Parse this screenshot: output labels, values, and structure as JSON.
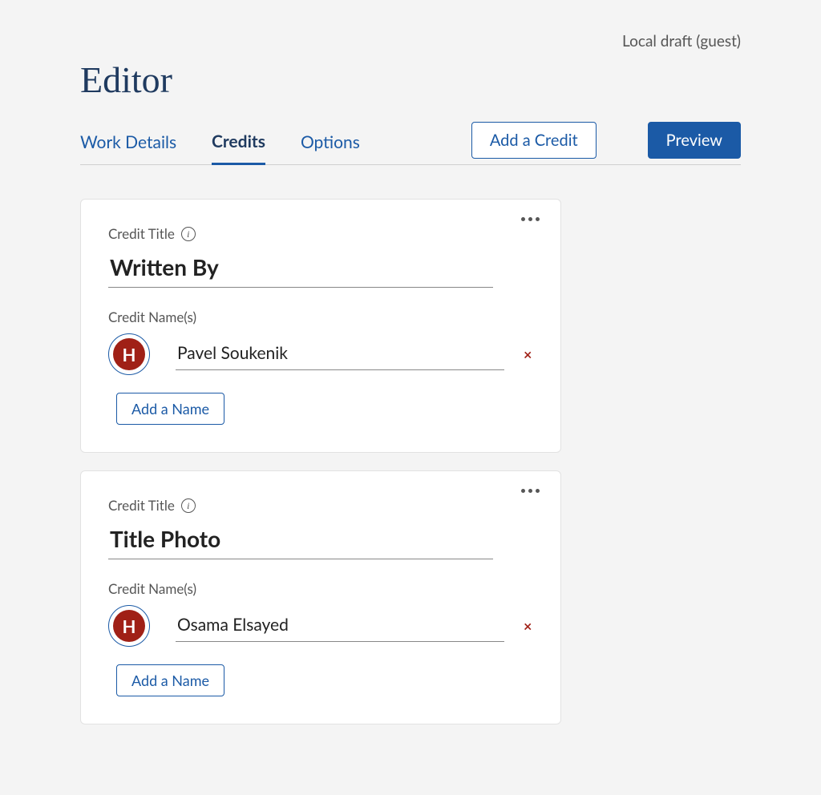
{
  "status_text": "Local draft (guest)",
  "page_title": "Editor",
  "tabs": [
    {
      "label": "Work Details",
      "active": false
    },
    {
      "label": "Credits",
      "active": true
    },
    {
      "label": "Options",
      "active": false
    }
  ],
  "buttons": {
    "add_credit": "Add a Credit",
    "preview": "Preview"
  },
  "field_labels": {
    "credit_title": "Credit Title",
    "credit_names": "Credit Name(s)",
    "add_name": "Add a Name",
    "info_glyph": "i"
  },
  "avatar_letter": "H",
  "remove_glyph": "×",
  "credits": [
    {
      "title": "Written By",
      "names": [
        {
          "name": "Pavel Soukenik"
        }
      ]
    },
    {
      "title": "Title Photo",
      "names": [
        {
          "name": "Osama Elsayed"
        }
      ]
    }
  ]
}
